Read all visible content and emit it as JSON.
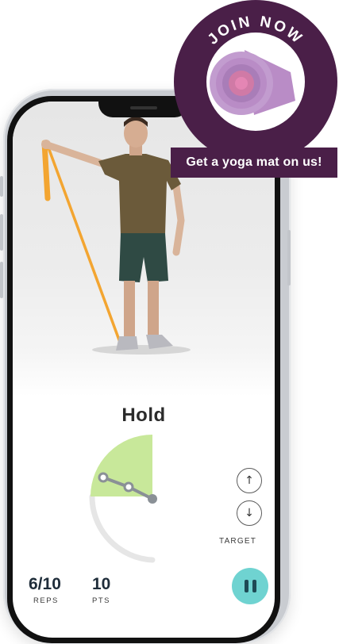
{
  "workout": {
    "phase_label": "Hold",
    "target_label": "TARGET",
    "reps_value": "6/10",
    "reps_label": "REPS",
    "points_value": "10",
    "points_label": "PTS"
  },
  "promo": {
    "arc_text": "JOIN NOW",
    "ribbon_text": "Get a yoga mat on us!"
  },
  "colors": {
    "accent_teal": "#6fd3d1",
    "gauge_green": "#c8e89a",
    "promo_purple": "#4a1f48",
    "band_orange": "#f3a531"
  },
  "icons": {
    "up": "arrow-up-icon",
    "down": "arrow-down-icon",
    "pause": "pause-icon"
  }
}
